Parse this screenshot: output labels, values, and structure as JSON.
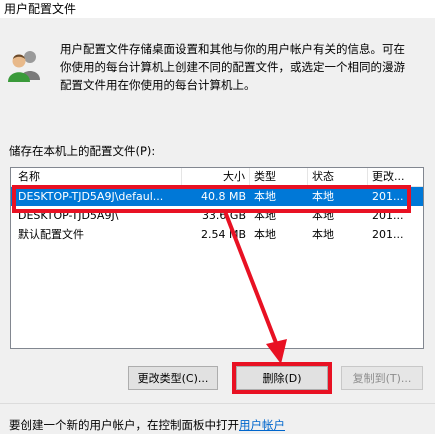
{
  "window": {
    "title": "用户配置文件"
  },
  "description": "用户配置文件存储桌面设置和其他与你的用户帐户有关的信息。可在\n你使用的每台计算机上创建不同的配置文件，或选定一个相同的漫游\n配置文件用在你使用的每台计算机上。",
  "list": {
    "label": "储存在本机上的配置文件(P):",
    "columns": [
      "名称",
      "大小",
      "类型",
      "状态",
      "更改..."
    ],
    "rows": [
      {
        "name": "DESKTOP-TJD5A9J\\defaul...",
        "size": "40.8 MB",
        "type": "本地",
        "status": "本地",
        "modified": "201..."
      },
      {
        "name": "DESKTOP-TJD5A9J\\",
        "size": "33.6 GB",
        "type": "本地",
        "status": "本地",
        "modified": "201..."
      },
      {
        "name": "默认配置文件",
        "size": "2.54 MB",
        "type": "本地",
        "status": "本地",
        "modified": "201..."
      }
    ]
  },
  "buttons": {
    "change_type": "更改类型(C)...",
    "delete": "删除(D)",
    "copy_to": "复制到(T)..."
  },
  "footer": {
    "text": "要创建一个新的用户帐户，在控制面板中打开",
    "link": "用户帐户"
  },
  "colors": {
    "highlight": "#e81123",
    "selection": "#0078d7",
    "link": "#0066cc"
  }
}
